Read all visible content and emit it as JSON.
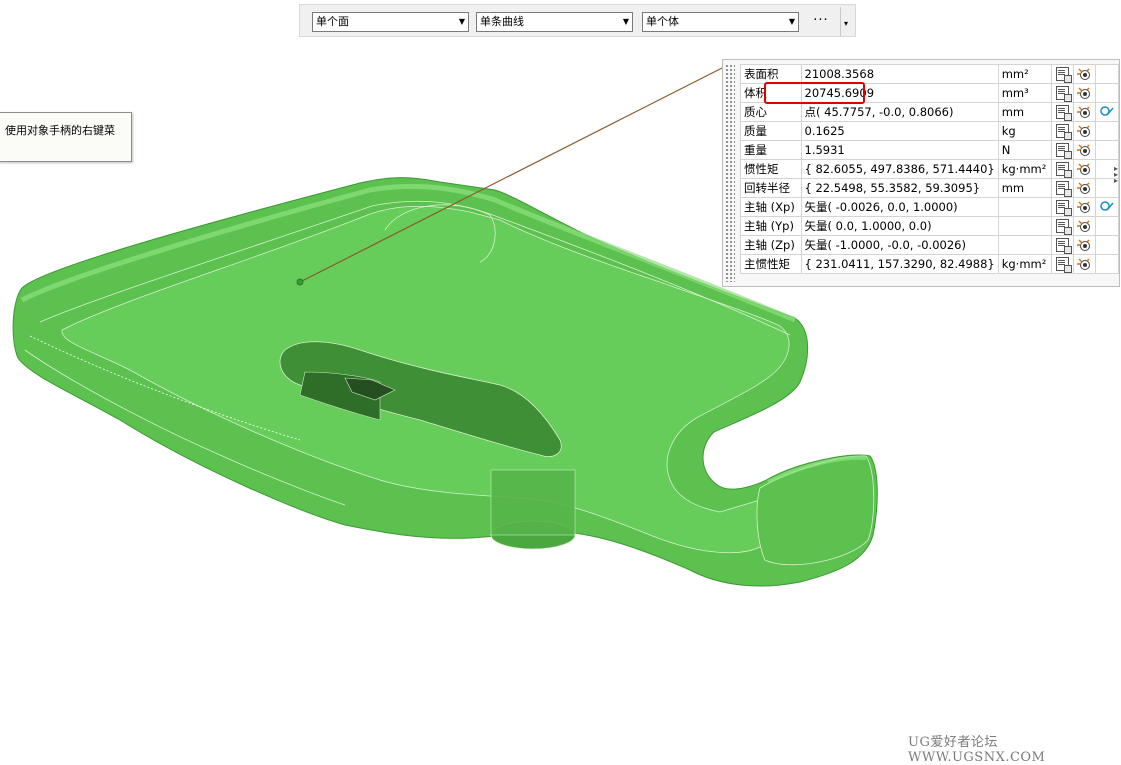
{
  "selection_bar": {
    "face_filter": "单个面",
    "curve_filter": "单条曲线",
    "body_filter": "单个体",
    "more_label": "···",
    "dropdown_arrow": "▾"
  },
  "tooltip": {
    "text": "使用对象手柄的右键菜"
  },
  "model": {
    "color": "#5cc14f",
    "edge_color": "#cfe8c4"
  },
  "properties": {
    "rows": [
      {
        "name": "表面积",
        "value": "21008.3568",
        "unit": "mm²",
        "extra": false
      },
      {
        "name": "体积",
        "value": "20745.6909",
        "unit": "mm³",
        "extra": false
      },
      {
        "name": "质心",
        "value": "点( 45.7757, -0.0, 0.8066)",
        "unit": "mm",
        "extra": true
      },
      {
        "name": "质量",
        "value": "0.1625",
        "unit": "kg",
        "extra": false
      },
      {
        "name": "重量",
        "value": "1.5931",
        "unit": "N",
        "extra": false
      },
      {
        "name": "惯性矩",
        "value": "{ 82.6055, 497.8386, 571.4440}",
        "unit": "kg·mm²",
        "extra": false
      },
      {
        "name": "回转半径",
        "value": "{ 22.5498, 55.3582, 59.3095}",
        "unit": "mm",
        "extra": false
      },
      {
        "name": "主轴 (Xp)",
        "value": "矢量( -0.0026, 0.0, 1.0000)",
        "unit": "",
        "extra": true
      },
      {
        "name": "主轴 (Yp)",
        "value": "矢量( 0.0, 1.0000, 0.0)",
        "unit": "",
        "extra": false
      },
      {
        "name": "主轴 (Zp)",
        "value": "矢量( -1.0000, -0.0, -0.0026)",
        "unit": "",
        "extra": false
      },
      {
        "name": "主惯性矩",
        "value": "{ 231.0411, 157.3290, 82.4988}",
        "unit": "kg·mm²",
        "extra": false
      }
    ],
    "highlight_color": "#e00000"
  },
  "watermark": "UG爱好者论坛 WWW.UGSNX.COM"
}
